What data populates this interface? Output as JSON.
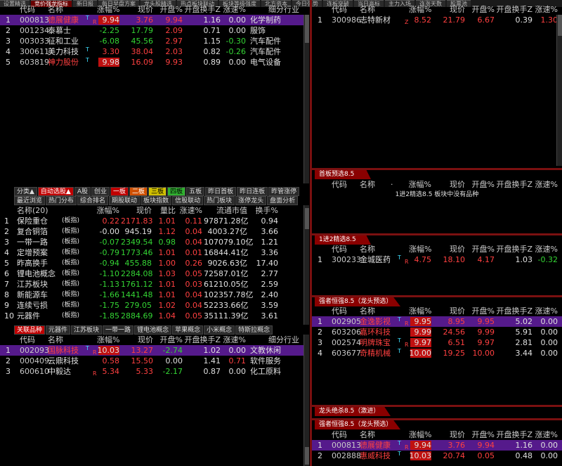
{
  "top_tabs": [
    "设置精选",
    "竞价强龙指标",
    "新日报",
    "每日早盘方案",
    "龙头股精选",
    "热点板块联动",
    "板块等级强度",
    "北方资本",
    "今日强势",
    "连板突破",
    "当日高标",
    "主力入场",
    "连涨天数",
    "股票池"
  ],
  "colors": {
    "up": "#ff4040",
    "down": "#34d534",
    "highlight": "#551a8b",
    "accent": "#8a0000"
  },
  "tl": {
    "headers": [
      "代码",
      "名称",
      "涨幅%",
      "现价",
      "开盘%",
      "开盘换手Z",
      "涨速%",
      "细分行业"
    ],
    "rows": [
      {
        "n": "1",
        "code": "000813",
        "name": "德展健康",
        "mark": "T",
        "flag": "R",
        "chg": "9.94",
        "price": "3.76",
        "open": "9.94",
        "turn": "1.16",
        "speed": "0.00",
        "ind": "化学制药",
        "sel": true
      },
      {
        "n": "2",
        "code": "001234",
        "name": "泰慕士",
        "mark": "",
        "flag": "",
        "chg": "-2.25",
        "price": "17.79",
        "open": "2.09",
        "turn": "0.71",
        "speed": "0.00",
        "ind": "服饰"
      },
      {
        "n": "3",
        "code": "003033",
        "name": "征和工业",
        "mark": "",
        "flag": "",
        "chg": "-6.08",
        "price": "45.56",
        "open": "2.97",
        "turn": "1.15",
        "speed": "-0.30",
        "ind": "汽车配件"
      },
      {
        "n": "4",
        "code": "300611",
        "name": "美力科技",
        "mark": "T",
        "flag": "",
        "chg": "3.30",
        "price": "38.04",
        "open": "2.03",
        "turn": "0.82",
        "speed": "-0.26",
        "ind": "汽车配件"
      },
      {
        "n": "5",
        "code": "603819",
        "name": "神力股份",
        "mark": "T",
        "flag": "",
        "chg": "9.98",
        "price": "16.09",
        "open": "9.93",
        "turn": "0.89",
        "speed": "0.00",
        "ind": "电气设备"
      }
    ]
  },
  "tr": {
    "headers": [
      "代码",
      "名称",
      "涨幅%",
      "现价",
      "开盘%",
      "开盘换手Z",
      "涨速%"
    ],
    "rows": [
      {
        "n": "1",
        "code": "300986",
        "name": "志特新材",
        "flag": "Z",
        "chg": "8.52",
        "price": "21.79",
        "open": "6.67",
        "turn": "0.39",
        "speed": "1.30"
      }
    ]
  },
  "mid_buttons": [
    "分类▲",
    "自动选股▲",
    "A股",
    "创业",
    "一板",
    "二板",
    "三板",
    "四板",
    "五板",
    "昨日首板",
    "昨日连板",
    "昨管涨停"
  ],
  "mid_buttons2": [
    "最近浏览",
    "热门分布",
    "综合排名",
    "期股联动",
    "板块指数",
    "信股联动",
    "热门板块",
    "涨停龙头",
    "盘面分析"
  ],
  "sector": {
    "headers": [
      "名称(20)",
      "涨幅%",
      "现价",
      "量比",
      "涨速%",
      "流通市值",
      "换手%"
    ],
    "rows": [
      {
        "n": "1",
        "name": "保险重仓",
        "tag": "(板指)",
        "chg": "0.22",
        "price": "2171.83",
        "vr": "1.01",
        "sp": "0.11",
        "cap": "97871.28亿",
        "turn": "0.94"
      },
      {
        "n": "2",
        "name": "复合铜箔",
        "tag": "(板指)",
        "chg": "-0.00",
        "price": "945.19",
        "vr": "1.12",
        "sp": "0.04",
        "cap": "4003.27亿",
        "turn": "3.66"
      },
      {
        "n": "3",
        "name": "一带一路",
        "tag": "(板指)",
        "chg": "-0.07",
        "price": "2349.54",
        "vr": "0.98",
        "sp": "0.04",
        "cap": "107079.10亿",
        "turn": "1.21"
      },
      {
        "n": "4",
        "name": "定增预案",
        "tag": "(板指)",
        "chg": "-0.79",
        "price": "1773.46",
        "vr": "1.01",
        "sp": "0.01",
        "cap": "16844.41亿",
        "turn": "3.36"
      },
      {
        "n": "5",
        "name": "昨高换手",
        "tag": "(板指)",
        "chg": "-0.94",
        "price": "455.88",
        "vr": "1.00",
        "sp": "0.26",
        "cap": "9026.63亿",
        "turn": "17.40"
      },
      {
        "n": "6",
        "name": "锂电池概念",
        "tag": "(板指)",
        "chg": "-1.10",
        "price": "2284.08",
        "vr": "1.03",
        "sp": "0.05",
        "cap": "72587.01亿",
        "turn": "2.77"
      },
      {
        "n": "7",
        "name": "江苏板块",
        "tag": "(板指)",
        "chg": "-1.13",
        "price": "1761.12",
        "vr": "1.01",
        "sp": "0.03",
        "cap": "61210.05亿",
        "turn": "2.59"
      },
      {
        "n": "8",
        "name": "新能源车",
        "tag": "(板指)",
        "chg": "-1.66",
        "price": "1441.48",
        "vr": "1.01",
        "sp": "0.04",
        "cap": "102357.78亿",
        "turn": "2.40"
      },
      {
        "n": "9",
        "name": "连续亏损",
        "tag": "(板指)",
        "chg": "-1.75",
        "price": "279.05",
        "vr": "1.02",
        "sp": "0.04",
        "cap": "52233.66亿",
        "turn": "3.59"
      },
      {
        "n": "10",
        "name": "元器件",
        "tag": "(板指)",
        "chg": "-1.85",
        "price": "2884.69",
        "vr": "1.04",
        "sp": "0.05",
        "cap": "35111.39亿",
        "turn": "3.61"
      }
    ]
  },
  "rel_tabs": [
    "关联品种",
    "元器件",
    "江苏板块",
    "一带一路",
    "锂电池概念",
    "苹果概念",
    "小米概念",
    "特斯拉概念"
  ],
  "rel": {
    "headers": [
      "代码",
      "名称",
      "涨幅%",
      "现价",
      "开盘%",
      "开盘换手Z",
      "涨速%",
      "细分行业"
    ],
    "rows": [
      {
        "n": "1",
        "code": "002093",
        "name": "国脉科技",
        "mark": "T",
        "flag": "R",
        "chg": "10.03",
        "price": "13.27",
        "open": "-2.74",
        "turn": "1.02",
        "speed": "0.00",
        "ind": "文教休闲",
        "sel": true
      },
      {
        "n": "2",
        "code": "000409",
        "name": "云鼎科技",
        "mark": "",
        "flag": "",
        "chg": "0.58",
        "price": "15.50",
        "open": "0.00",
        "turn": "1.41",
        "speed": "0.71",
        "ind": "软件服务"
      },
      {
        "n": "3",
        "code": "600610",
        "name": "中毅达",
        "mark": "",
        "flag": "R",
        "chg": "5.34",
        "price": "5.33",
        "open": "-2.17",
        "turn": "0.87",
        "speed": "0.00",
        "ind": "化工原料"
      }
    ]
  },
  "sec_first": {
    "title": "首板预选8.5",
    "headers": [
      "代码",
      "名称",
      "·",
      "涨幅%",
      "现价",
      "开盘%",
      "开盘换手Z",
      "涨速%"
    ],
    "empty": "1进2精选8.5 板块中没有品种"
  },
  "sec_1to2": {
    "title": "1进2精选8.5",
    "headers": [
      "代码",
      "名称",
      "涨幅%",
      "现价",
      "开盘%",
      "开盘换手Z",
      "涨速%"
    ],
    "rows": [
      {
        "n": "1",
        "code": "300233",
        "name": "金城医药",
        "mark": "T",
        "flag": "R",
        "chg": "4.75",
        "price": "18.10",
        "open": "4.17",
        "turn": "1.03",
        "speed": "-0.32"
      }
    ]
  },
  "sec_strong": {
    "title": "强者恒强8.5（龙头预选）",
    "headers": [
      "代码",
      "名称",
      "涨幅%",
      "现价",
      "开盘%",
      "开盘换手Z",
      "涨速%"
    ],
    "rows": [
      {
        "n": "1",
        "code": "002905",
        "name": "金逸影视",
        "mark": "T",
        "flag": "R",
        "chg": "9.95",
        "price": "8.95",
        "open": "9.95",
        "turn": "5.02",
        "speed": "0.00",
        "sel": true
      },
      {
        "n": "2",
        "code": "603206",
        "name": "嘉环科技",
        "mark": "",
        "flag": "",
        "chg": "9.99",
        "price": "24.56",
        "open": "9.99",
        "turn": "5.91",
        "speed": "0.00"
      },
      {
        "n": "3",
        "code": "002574",
        "name": "明牌珠宝",
        "mark": "T",
        "flag": "R",
        "chg": "9.97",
        "price": "6.51",
        "open": "9.97",
        "turn": "2.81",
        "speed": "0.00"
      },
      {
        "n": "4",
        "code": "603677",
        "name": "奇精机械",
        "mark": "T",
        "flag": "",
        "chg": "10.00",
        "price": "19.25",
        "open": "10.00",
        "turn": "3.44",
        "speed": "0.00"
      }
    ]
  },
  "sec_kill": {
    "title": "龙头绝杀8.5（激进）"
  },
  "sec_strong2": {
    "title": "强者恒强8.5（龙头预选）",
    "headers": [
      "代码",
      "名称",
      "涨幅%",
      "现价",
      "开盘%",
      "开盘换手Z",
      "涨速%"
    ],
    "rows": [
      {
        "n": "1",
        "code": "000813",
        "name": "德展健康",
        "mark": "T",
        "flag": "R",
        "chg": "9.94",
        "price": "3.76",
        "open": "9.94",
        "turn": "1.16",
        "speed": "0.00",
        "sel": true
      },
      {
        "n": "2",
        "code": "002888",
        "name": "惠威科技",
        "mark": "T",
        "flag": "",
        "chg": "10.03",
        "price": "20.74",
        "open": "0.05",
        "turn": "0.48",
        "speed": "0.00"
      }
    ]
  }
}
